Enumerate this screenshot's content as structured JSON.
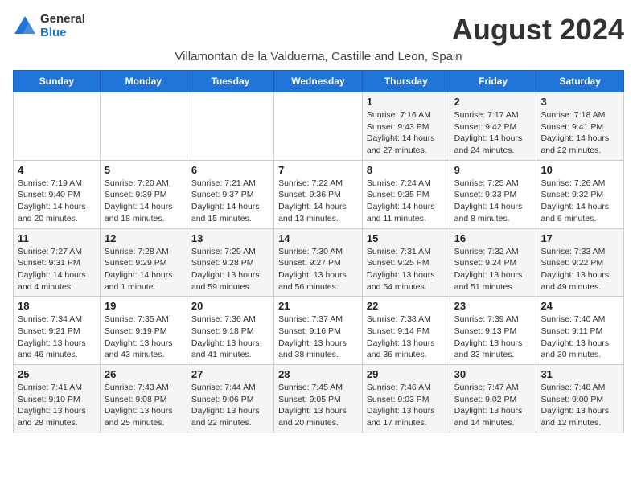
{
  "header": {
    "logo_line1": "General",
    "logo_line2": "Blue",
    "month_title": "August 2024",
    "subtitle": "Villamontan de la Valduerna, Castille and Leon, Spain"
  },
  "columns": [
    "Sunday",
    "Monday",
    "Tuesday",
    "Wednesday",
    "Thursday",
    "Friday",
    "Saturday"
  ],
  "weeks": [
    [
      {
        "day": "",
        "detail": ""
      },
      {
        "day": "",
        "detail": ""
      },
      {
        "day": "",
        "detail": ""
      },
      {
        "day": "",
        "detail": ""
      },
      {
        "day": "1",
        "detail": "Sunrise: 7:16 AM\nSunset: 9:43 PM\nDaylight: 14 hours and 27 minutes."
      },
      {
        "day": "2",
        "detail": "Sunrise: 7:17 AM\nSunset: 9:42 PM\nDaylight: 14 hours and 24 minutes."
      },
      {
        "day": "3",
        "detail": "Sunrise: 7:18 AM\nSunset: 9:41 PM\nDaylight: 14 hours and 22 minutes."
      }
    ],
    [
      {
        "day": "4",
        "detail": "Sunrise: 7:19 AM\nSunset: 9:40 PM\nDaylight: 14 hours and 20 minutes."
      },
      {
        "day": "5",
        "detail": "Sunrise: 7:20 AM\nSunset: 9:39 PM\nDaylight: 14 hours and 18 minutes."
      },
      {
        "day": "6",
        "detail": "Sunrise: 7:21 AM\nSunset: 9:37 PM\nDaylight: 14 hours and 15 minutes."
      },
      {
        "day": "7",
        "detail": "Sunrise: 7:22 AM\nSunset: 9:36 PM\nDaylight: 14 hours and 13 minutes."
      },
      {
        "day": "8",
        "detail": "Sunrise: 7:24 AM\nSunset: 9:35 PM\nDaylight: 14 hours and 11 minutes."
      },
      {
        "day": "9",
        "detail": "Sunrise: 7:25 AM\nSunset: 9:33 PM\nDaylight: 14 hours and 8 minutes."
      },
      {
        "day": "10",
        "detail": "Sunrise: 7:26 AM\nSunset: 9:32 PM\nDaylight: 14 hours and 6 minutes."
      }
    ],
    [
      {
        "day": "11",
        "detail": "Sunrise: 7:27 AM\nSunset: 9:31 PM\nDaylight: 14 hours and 4 minutes."
      },
      {
        "day": "12",
        "detail": "Sunrise: 7:28 AM\nSunset: 9:29 PM\nDaylight: 14 hours and 1 minute."
      },
      {
        "day": "13",
        "detail": "Sunrise: 7:29 AM\nSunset: 9:28 PM\nDaylight: 13 hours and 59 minutes."
      },
      {
        "day": "14",
        "detail": "Sunrise: 7:30 AM\nSunset: 9:27 PM\nDaylight: 13 hours and 56 minutes."
      },
      {
        "day": "15",
        "detail": "Sunrise: 7:31 AM\nSunset: 9:25 PM\nDaylight: 13 hours and 54 minutes."
      },
      {
        "day": "16",
        "detail": "Sunrise: 7:32 AM\nSunset: 9:24 PM\nDaylight: 13 hours and 51 minutes."
      },
      {
        "day": "17",
        "detail": "Sunrise: 7:33 AM\nSunset: 9:22 PM\nDaylight: 13 hours and 49 minutes."
      }
    ],
    [
      {
        "day": "18",
        "detail": "Sunrise: 7:34 AM\nSunset: 9:21 PM\nDaylight: 13 hours and 46 minutes."
      },
      {
        "day": "19",
        "detail": "Sunrise: 7:35 AM\nSunset: 9:19 PM\nDaylight: 13 hours and 43 minutes."
      },
      {
        "day": "20",
        "detail": "Sunrise: 7:36 AM\nSunset: 9:18 PM\nDaylight: 13 hours and 41 minutes."
      },
      {
        "day": "21",
        "detail": "Sunrise: 7:37 AM\nSunset: 9:16 PM\nDaylight: 13 hours and 38 minutes."
      },
      {
        "day": "22",
        "detail": "Sunrise: 7:38 AM\nSunset: 9:14 PM\nDaylight: 13 hours and 36 minutes."
      },
      {
        "day": "23",
        "detail": "Sunrise: 7:39 AM\nSunset: 9:13 PM\nDaylight: 13 hours and 33 minutes."
      },
      {
        "day": "24",
        "detail": "Sunrise: 7:40 AM\nSunset: 9:11 PM\nDaylight: 13 hours and 30 minutes."
      }
    ],
    [
      {
        "day": "25",
        "detail": "Sunrise: 7:41 AM\nSunset: 9:10 PM\nDaylight: 13 hours and 28 minutes."
      },
      {
        "day": "26",
        "detail": "Sunrise: 7:43 AM\nSunset: 9:08 PM\nDaylight: 13 hours and 25 minutes."
      },
      {
        "day": "27",
        "detail": "Sunrise: 7:44 AM\nSunset: 9:06 PM\nDaylight: 13 hours and 22 minutes."
      },
      {
        "day": "28",
        "detail": "Sunrise: 7:45 AM\nSunset: 9:05 PM\nDaylight: 13 hours and 20 minutes."
      },
      {
        "day": "29",
        "detail": "Sunrise: 7:46 AM\nSunset: 9:03 PM\nDaylight: 13 hours and 17 minutes."
      },
      {
        "day": "30",
        "detail": "Sunrise: 7:47 AM\nSunset: 9:02 PM\nDaylight: 13 hours and 14 minutes."
      },
      {
        "day": "31",
        "detail": "Sunrise: 7:48 AM\nSunset: 9:00 PM\nDaylight: 13 hours and 12 minutes."
      }
    ]
  ]
}
